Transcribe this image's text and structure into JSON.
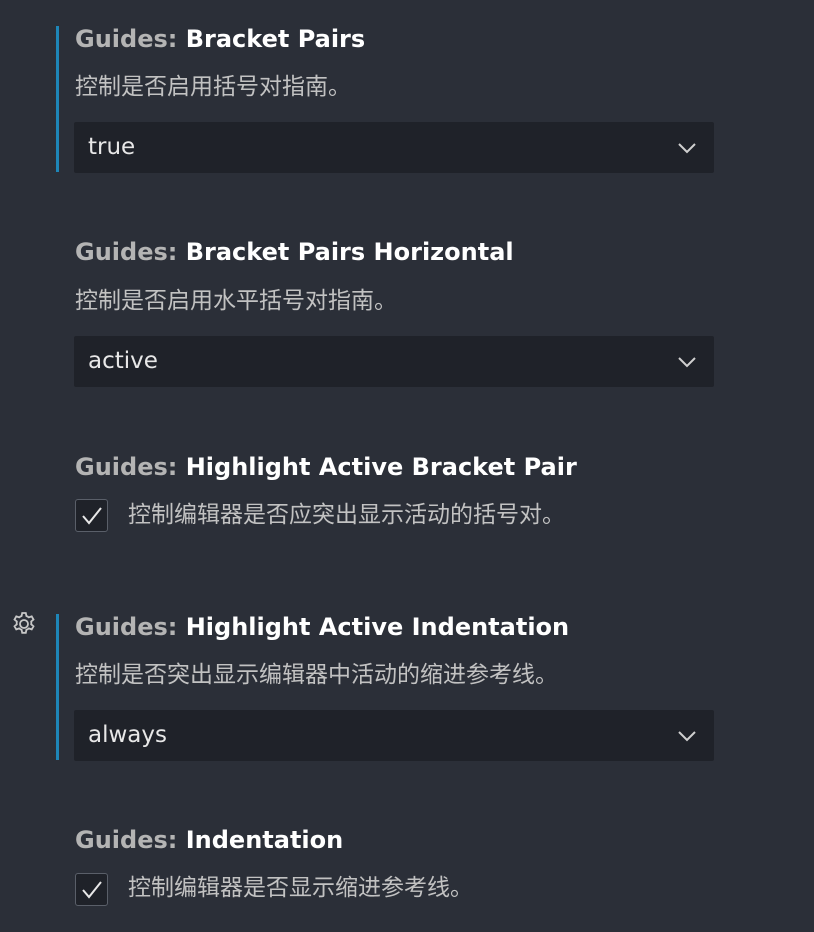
{
  "settings": [
    {
      "category": "Guides: ",
      "name": "Bracket Pairs",
      "description": "控制是否启用括号对指南。",
      "value": "true"
    },
    {
      "category": "Guides: ",
      "name": "Bracket Pairs Horizontal",
      "description": "控制是否启用水平括号对指南。",
      "value": "active"
    },
    {
      "category": "Guides: ",
      "name": "Highlight Active Bracket Pair",
      "description": "控制编辑器是否应突出显示活动的括号对。",
      "checked": true
    },
    {
      "category": "Guides: ",
      "name": "Highlight Active Indentation",
      "description": "控制是否突出显示编辑器中活动的缩进参考线。",
      "value": "always"
    },
    {
      "category": "Guides: ",
      "name": "Indentation",
      "description": "控制编辑器是否显示缩进参考线。",
      "checked": true
    }
  ],
  "icons": {
    "dropdown": "chevron-down-icon",
    "check": "checkmark-icon",
    "settings_gear": "gear-icon"
  },
  "colors": {
    "background": "#2b2f38",
    "modified_indicator": "#1e86b8",
    "control_background": "#1f2229",
    "title_category": "#b4b4b4",
    "title_name": "#ffffff"
  }
}
